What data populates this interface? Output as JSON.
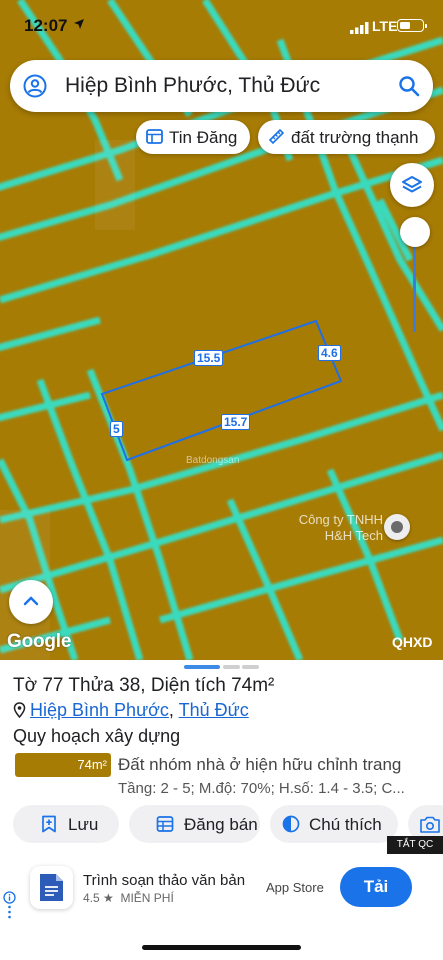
{
  "status": {
    "time": "12:07",
    "network": "LTE"
  },
  "search": {
    "query": "Hiệp Bình Phước, Thủ Đức"
  },
  "chips": [
    {
      "label": "Tin Đăng",
      "icon": "listing-icon"
    },
    {
      "label": "đất trường thạnh",
      "icon": "ruler-icon"
    }
  ],
  "map": {
    "dimensions": [
      "15.5",
      "4.6",
      "5",
      "15.7"
    ],
    "watermark": "Batdongsan",
    "company": "Công ty TNHH H&H Tech",
    "attribution": "Google",
    "layer": "QHXD",
    "zone_color": "#a77c05",
    "road_color": "#34e0c8"
  },
  "parcel": {
    "title": "Tờ 77 Thửa 38, Diện tích 74m²",
    "ward": "Hiệp Bình Phước",
    "separator": ",",
    "district": "Thủ Đức",
    "plan_heading": "Quy hoạch xây dựng",
    "area_badge": "74m²",
    "zone": "Đất nhóm nhà ở hiện hữu chỉnh trang",
    "params": "Tầng: 2 - 5; M.độ: 70%; H.số: 1.4 - 3.5; C..."
  },
  "actions": [
    {
      "label": "Lưu",
      "icon": "bookmark-plus-icon"
    },
    {
      "label": "Đăng bán",
      "icon": "calendar-grid-icon"
    },
    {
      "label": "Chú thích",
      "icon": "contrast-icon"
    },
    {
      "label": "",
      "icon": "camera-plus-icon"
    }
  ],
  "ad": {
    "close_label": "TẮT QC",
    "app_name": "Trình soạn thảo văn bản",
    "rating": "4.5 ★",
    "price": "MIỄN PHÍ",
    "store": "App Store",
    "cta": "Tải"
  }
}
